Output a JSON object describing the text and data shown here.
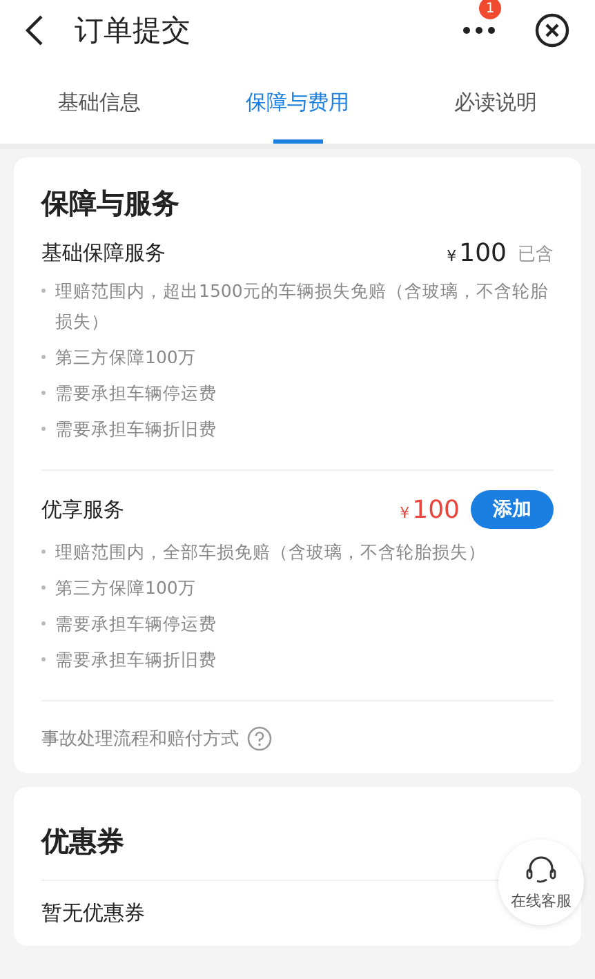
{
  "header": {
    "title": "订单提交",
    "badge": "1"
  },
  "tabs": [
    {
      "label": "基础信息",
      "selected": false
    },
    {
      "label": "保障与费用",
      "selected": true
    },
    {
      "label": "必读说明",
      "selected": false
    }
  ],
  "protection": {
    "title": "保障与服务",
    "services": [
      {
        "kind": "included",
        "name": "基础保障服务",
        "currency": "¥",
        "price": "100",
        "status": "已含",
        "items": [
          "理赔范围内，超出1500元的车辆损失免赔（含玻璃，不含轮胎损失）",
          "第三方保障100万",
          "需要承担车辆停运费",
          "需要承担车辆折旧费"
        ]
      },
      {
        "kind": "optional",
        "name": "优享服务",
        "currency": "¥",
        "price": "100",
        "action": "添加",
        "items": [
          "理赔范围内，全部车损免赔（含玻璃，不含轮胎损失）",
          "第三方保障100万",
          "需要承担车辆停运费",
          "需要承担车辆折旧费"
        ]
      }
    ],
    "link": "事故处理流程和赔付方式"
  },
  "coupons": {
    "title": "优惠券",
    "empty": "暂无优惠券"
  },
  "support": {
    "label": "在线客服"
  }
}
